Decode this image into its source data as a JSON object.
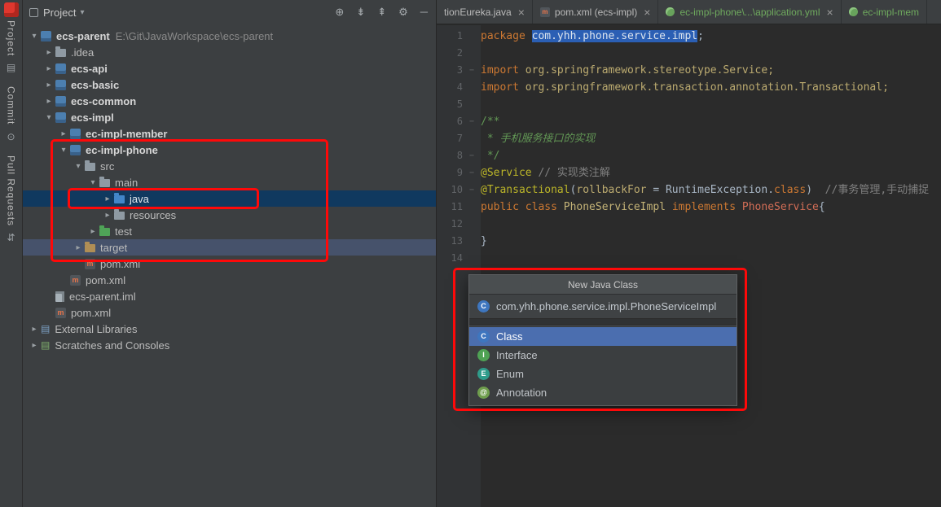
{
  "colors": {
    "annotation_red": "#fe0909",
    "editor_selection_blue": "#2b5fb4",
    "tree_selection_blue": "#10395f"
  },
  "activity_bar": {
    "items": [
      {
        "label": "Project",
        "icon": "project"
      },
      {
        "label": "Commit",
        "icon": "commit"
      },
      {
        "label": "Pull Requests",
        "icon": "pull-requests"
      }
    ]
  },
  "project_panel": {
    "header": {
      "title": "Project",
      "actions": [
        {
          "icon": "locate"
        },
        {
          "icon": "expand-all"
        },
        {
          "icon": "collapse-all"
        },
        {
          "icon": "settings"
        },
        {
          "icon": "hide"
        }
      ]
    },
    "tree": [
      {
        "label": "ecs-parent",
        "hint": "E:\\Git\\JavaWorkspace\\ecs-parent",
        "indent": 0,
        "chevron": "down",
        "icon": "module",
        "bold": true
      },
      {
        "label": ".idea",
        "indent": 1,
        "chevron": "right",
        "icon": "folder",
        "icon_color": "#8f9aa3"
      },
      {
        "label": "ecs-api",
        "indent": 1,
        "chevron": "right",
        "icon": "module",
        "bold": true
      },
      {
        "label": "ecs-basic",
        "indent": 1,
        "chevron": "right",
        "icon": "module",
        "bold": true
      },
      {
        "label": "ecs-common",
        "indent": 1,
        "chevron": "right",
        "icon": "module",
        "bold": true
      },
      {
        "label": "ecs-impl",
        "indent": 1,
        "chevron": "down",
        "icon": "module",
        "bold": true
      },
      {
        "label": "ec-impl-member",
        "indent": 2,
        "chevron": "right",
        "icon": "module",
        "bold": true
      },
      {
        "label": "ec-impl-phone",
        "indent": 2,
        "chevron": "down",
        "icon": "module",
        "bold": true
      },
      {
        "label": "src",
        "indent": 3,
        "chevron": "down",
        "icon": "folder",
        "icon_color": "#8f9aa3"
      },
      {
        "label": "main",
        "indent": 4,
        "chevron": "down",
        "icon": "folder",
        "icon_color": "#8f9aa3"
      },
      {
        "label": "java",
        "indent": 5,
        "chevron": "right",
        "icon": "folder",
        "icon_color": "#4286c9",
        "row": "selected"
      },
      {
        "label": "resources",
        "indent": 5,
        "chevron": "right",
        "icon": "folder",
        "icon_color": "#8f9aa3"
      },
      {
        "label": "test",
        "indent": 4,
        "chevron": "right",
        "icon": "folder",
        "icon_color": "#4fa457"
      },
      {
        "label": "target",
        "indent": 3,
        "chevron": "right",
        "icon": "folder",
        "icon_color": "#b08e55",
        "row": "highlighted"
      },
      {
        "label": "pom.xml",
        "indent": 3,
        "icon": "maven"
      },
      {
        "label": "pom.xml",
        "indent": 2,
        "icon": "maven"
      },
      {
        "label": "ecs-parent.iml",
        "indent": 1,
        "icon": "file"
      },
      {
        "label": "pom.xml",
        "indent": 1,
        "icon": "maven"
      },
      {
        "label": "External Libraries",
        "indent": 0,
        "chevron": "right",
        "icon": "libraries"
      },
      {
        "label": "Scratches and Consoles",
        "indent": 0,
        "chevron": "right",
        "icon": "scratches"
      }
    ]
  },
  "editor": {
    "tabs": [
      {
        "label": "tionEureka.java",
        "icon": "none",
        "green": false,
        "closable": true
      },
      {
        "label": "pom.xml (ecs-impl)",
        "icon": "maven",
        "green": false,
        "closable": true
      },
      {
        "label": "ec-impl-phone\\...\\application.yml",
        "icon": "spring",
        "green": true,
        "closable": true
      },
      {
        "label": "ec-impl-mem",
        "icon": "spring",
        "green": true,
        "closable": false
      }
    ],
    "lines": [
      {
        "n": 1,
        "tokens": [
          {
            "t": "package ",
            "c": "kw"
          },
          {
            "t": "com.yhh.phone.service.impl",
            "c": "sel"
          },
          {
            "t": ";",
            "c": "pln"
          }
        ]
      },
      {
        "n": 2,
        "tokens": []
      },
      {
        "n": 3,
        "fold": true,
        "tokens": [
          {
            "t": "import ",
            "c": "kw"
          },
          {
            "t": "org.springframework.stereotype.Service;",
            "c": "imp"
          }
        ]
      },
      {
        "n": 4,
        "tokens": [
          {
            "t": "import ",
            "c": "kw"
          },
          {
            "t": "org.springframework.transaction.annotation.Transactional;",
            "c": "imp"
          }
        ]
      },
      {
        "n": 5,
        "tokens": []
      },
      {
        "n": 6,
        "fold": true,
        "tokens": [
          {
            "t": "/**",
            "c": "doc"
          }
        ]
      },
      {
        "n": 7,
        "tokens": [
          {
            "t": " * 手机服务接口的实现",
            "c": "doci"
          }
        ]
      },
      {
        "n": 8,
        "fold": true,
        "tokens": [
          {
            "t": " */",
            "c": "doc"
          }
        ]
      },
      {
        "n": 9,
        "fold": true,
        "tokens": [
          {
            "t": "@Service ",
            "c": "ann"
          },
          {
            "t": "// 实现类注解",
            "c": "cmt"
          }
        ]
      },
      {
        "n": 10,
        "fold": true,
        "tokens": [
          {
            "t": "@Transactional",
            "c": "ann"
          },
          {
            "t": "(",
            "c": "pln"
          },
          {
            "t": "rollbackFor",
            "c": "imp"
          },
          {
            "t": " = ",
            "c": "pln"
          },
          {
            "t": "RuntimeException",
            "c": "pln"
          },
          {
            "t": ".",
            "c": "pln"
          },
          {
            "t": "class",
            "c": "kw"
          },
          {
            "t": ")  ",
            "c": "pln"
          },
          {
            "t": "//事务管理,手动捕捉",
            "c": "cmt"
          }
        ]
      },
      {
        "n": 11,
        "tokens": [
          {
            "t": "public class ",
            "c": "kw"
          },
          {
            "t": "PhoneServiceImpl ",
            "c": "decl"
          },
          {
            "t": "implements ",
            "c": "kw"
          },
          {
            "t": "PhoneService",
            "c": "ref"
          },
          {
            "t": "{",
            "c": "pln"
          }
        ]
      },
      {
        "n": 12,
        "tokens": []
      },
      {
        "n": 13,
        "tokens": [
          {
            "t": "}",
            "c": "pln"
          }
        ]
      },
      {
        "n": 14,
        "tokens": []
      }
    ]
  },
  "popup": {
    "title": "New Java Class",
    "name_value": "com.yhh.phone.service.impl.PhoneServiceImpl",
    "options": [
      {
        "label": "Class",
        "kind": "C",
        "selected": true
      },
      {
        "label": "Interface",
        "kind": "I",
        "selected": false
      },
      {
        "label": "Enum",
        "kind": "E",
        "selected": false
      },
      {
        "label": "Annotation",
        "kind": "@",
        "selected": false
      }
    ]
  }
}
